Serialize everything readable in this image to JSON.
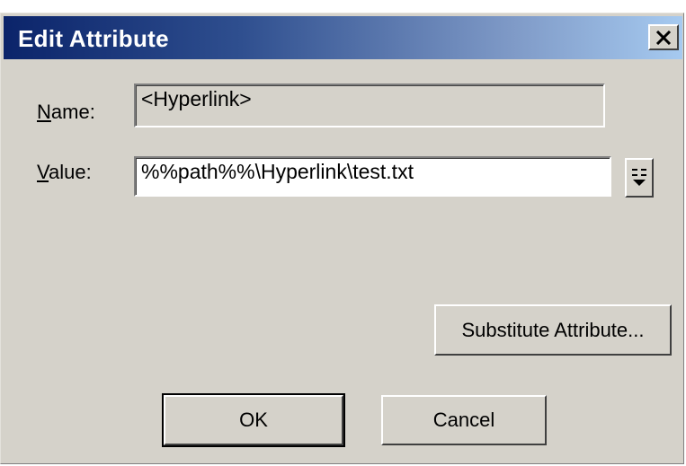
{
  "dialog": {
    "title": "Edit Attribute",
    "close_icon": "close-icon"
  },
  "name_field": {
    "label_accel": "N",
    "label_rest": "ame:",
    "value": "<Hyperlink>"
  },
  "value_field": {
    "label_accel": "V",
    "label_rest": "alue:",
    "value": "%%path%%\\Hyperlink\\test.txt",
    "browse_icon": "dropdown-list-icon"
  },
  "buttons": {
    "substitute": "Substitute Attribute...",
    "ok": "OK",
    "cancel": "Cancel"
  }
}
